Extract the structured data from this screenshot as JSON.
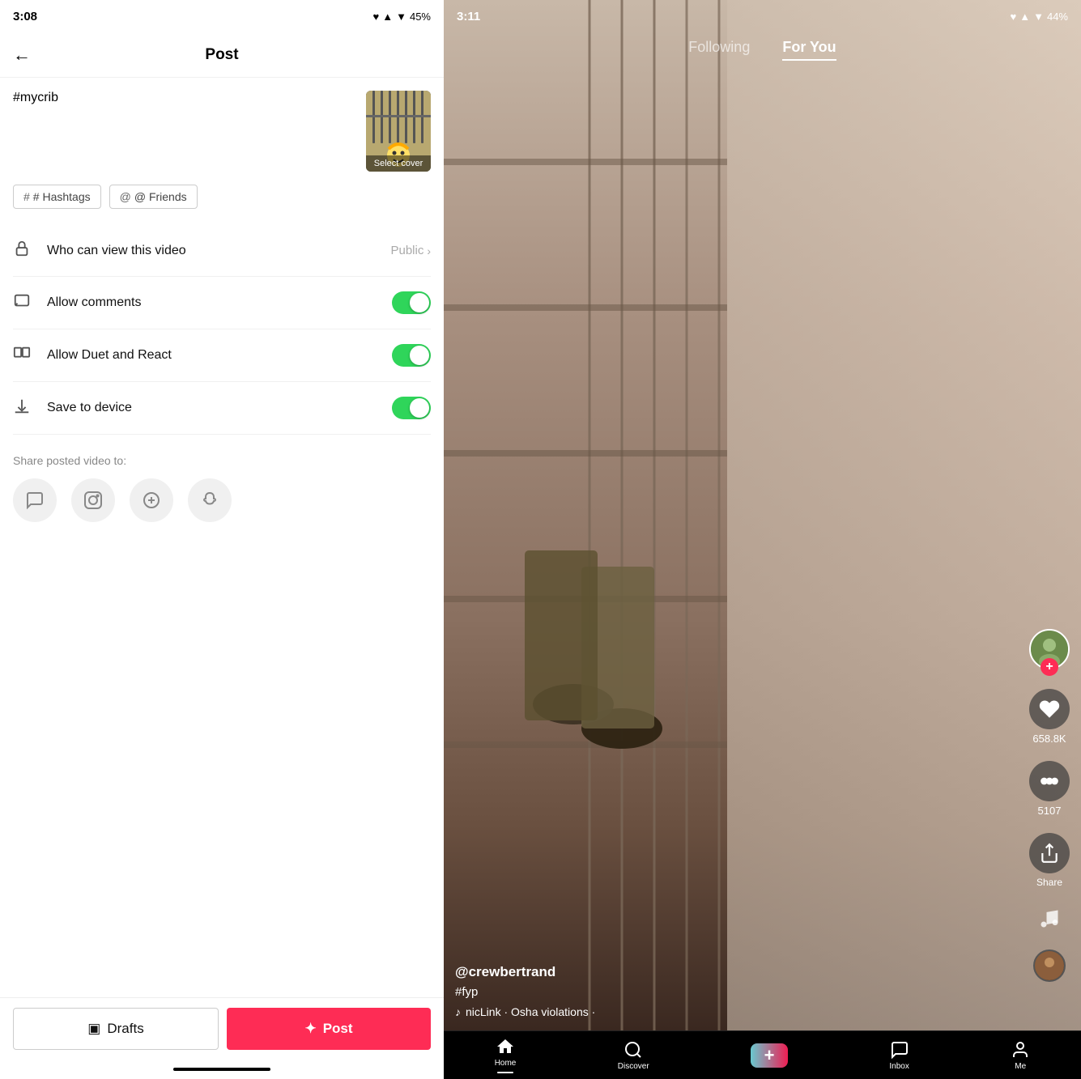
{
  "left": {
    "status": {
      "time": "3:08",
      "battery": "45%"
    },
    "header": {
      "title": "Post",
      "back_label": "←"
    },
    "caption": {
      "text": "#mycrib",
      "placeholder": "#mycrib"
    },
    "video": {
      "select_cover_label": "Select cover"
    },
    "tags": {
      "hashtag_label": "# Hashtags",
      "friends_label": "@ Friends"
    },
    "settings": [
      {
        "id": "who-can-view",
        "label": "Who can view this video",
        "value": "Public",
        "type": "select",
        "icon": "lock"
      },
      {
        "id": "allow-comments",
        "label": "Allow comments",
        "value": true,
        "type": "toggle",
        "icon": "comment"
      },
      {
        "id": "allow-duet",
        "label": "Allow Duet and React",
        "value": true,
        "type": "toggle",
        "icon": "duet"
      },
      {
        "id": "save-device",
        "label": "Save to device",
        "value": true,
        "type": "toggle",
        "icon": "download"
      }
    ],
    "share": {
      "label": "Share posted video to:",
      "platforms": [
        "message",
        "instagram",
        "tiktok-plus",
        "snapchat"
      ]
    },
    "buttons": {
      "drafts_label": "Drafts",
      "post_label": "Post"
    }
  },
  "right": {
    "status": {
      "time": "3:11",
      "battery": "44%"
    },
    "tabs": [
      {
        "id": "following",
        "label": "Following",
        "active": false
      },
      {
        "id": "for-you",
        "label": "For You",
        "active": true
      }
    ],
    "video": {
      "username": "@crewbertrand",
      "hashtag": "#fyp",
      "song": "nicLink · Osha violations ·"
    },
    "actions": {
      "likes": "658.8K",
      "comments": "5107",
      "share": "Share"
    },
    "nav": [
      {
        "id": "home",
        "label": "Home",
        "icon": "🏠",
        "active": true
      },
      {
        "id": "discover",
        "label": "Discover",
        "icon": "🔍",
        "active": false
      },
      {
        "id": "add",
        "label": "",
        "icon": "+",
        "active": false
      },
      {
        "id": "inbox",
        "label": "Inbox",
        "icon": "💬",
        "active": false
      },
      {
        "id": "me",
        "label": "Me",
        "icon": "👤",
        "active": false
      }
    ]
  }
}
